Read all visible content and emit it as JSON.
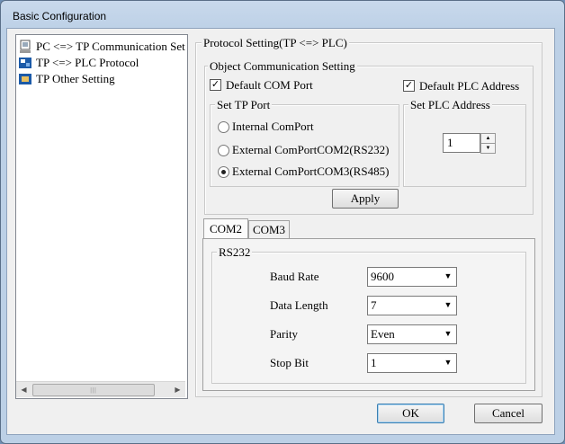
{
  "window": {
    "title": "Basic Configuration"
  },
  "tree": {
    "items": [
      {
        "label": "PC <=> TP Communication Set",
        "icon": "pc-communication-icon"
      },
      {
        "label": "TP <=> PLC Protocol",
        "icon": "plc-protocol-icon"
      },
      {
        "label": "TP Other Setting",
        "icon": "tp-settings-icon"
      }
    ]
  },
  "protocol": {
    "title": "Protocol Setting(TP <=> PLC)",
    "object_comm": {
      "title": "Object Communication Setting",
      "default_com_port": {
        "label": "Default COM Port",
        "checked": true
      },
      "default_plc_address": {
        "label": "Default PLC Address",
        "checked": true
      },
      "set_tp_port": {
        "title": "Set TP Port",
        "options": [
          {
            "label": "Internal ComPort",
            "selected": false
          },
          {
            "label": "External ComPortCOM2(RS232)",
            "selected": false
          },
          {
            "label": "External ComPortCOM3(RS485)",
            "selected": true
          }
        ]
      },
      "set_plc_address": {
        "title": "Set PLC Address",
        "value": "1"
      },
      "apply_label": "Apply"
    },
    "tabs": [
      {
        "label": "COM2",
        "active": true
      },
      {
        "label": "COM3",
        "active": false
      }
    ],
    "rs232": {
      "title": "RS232",
      "fields": [
        {
          "label": "Baud Rate",
          "value": "9600"
        },
        {
          "label": "Data Length",
          "value": "7"
        },
        {
          "label": "Parity",
          "value": "Even"
        },
        {
          "label": "Stop Bit",
          "value": "1"
        }
      ]
    }
  },
  "buttons": {
    "ok": "OK",
    "cancel": "Cancel"
  },
  "colors": {
    "frame": "#bcd0e6",
    "client": "#f0f0f0",
    "icon_blue": "#1b5aa8"
  }
}
